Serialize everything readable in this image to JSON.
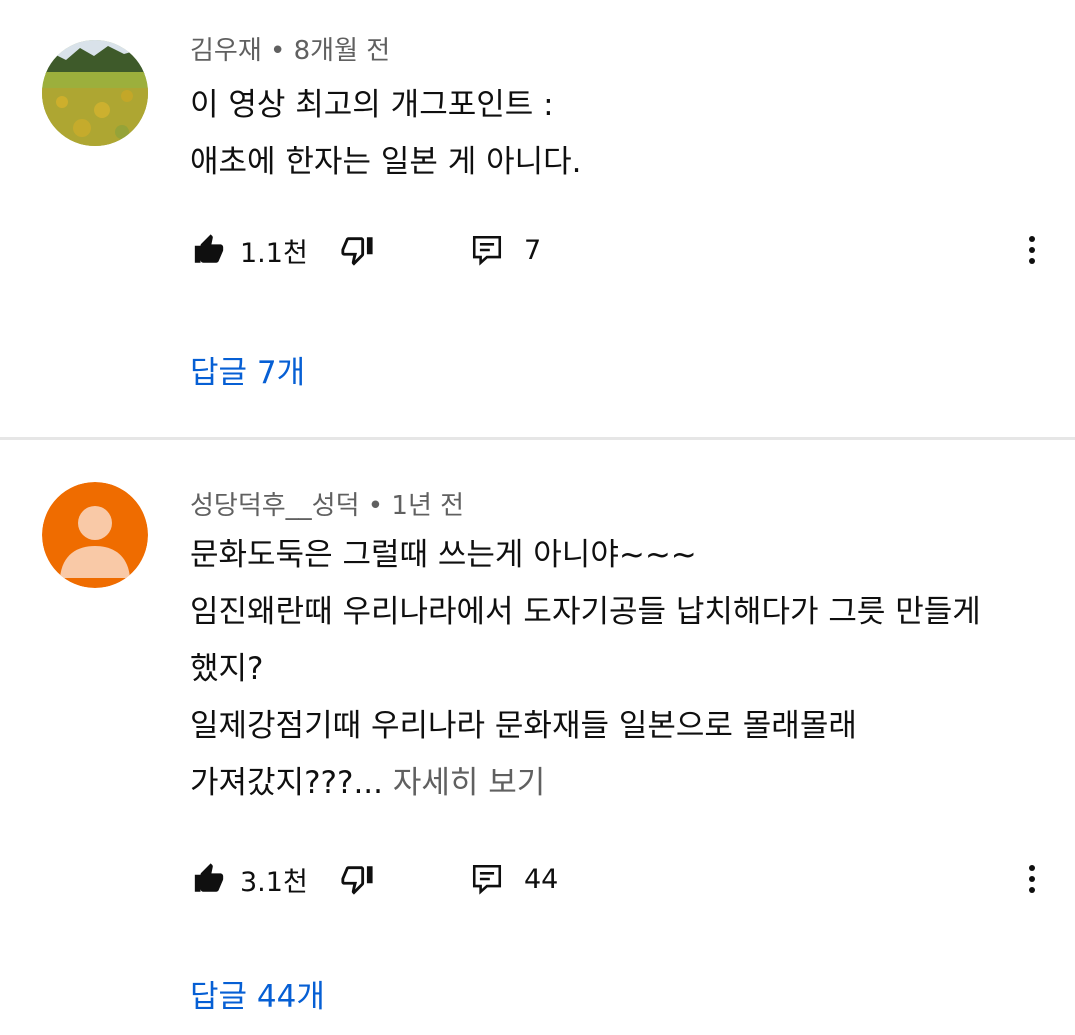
{
  "comments": [
    {
      "author": "김우재",
      "time": "8개월 전",
      "lines": [
        "이 영상 최고의 개그포인트 :",
        "애초에 한자는 일본 게 아니다."
      ],
      "more_label": "",
      "likes": "1.1천",
      "reply_count": "7",
      "replies_link": "답글 7개",
      "avatar": "landscape-photo-avatar"
    },
    {
      "author": "성당덕후__성덕",
      "time": "1년 전",
      "lines": [
        "문화도둑은 그럴때 쓰는게 아니야~~~",
        "임진왜란때 우리나라에서 도자기공들 납치해다가 그릇 만들게",
        "했지?",
        "일제강점기때 우리나라 문화재들 일본으로 몰래몰래",
        "가져갔지???..."
      ],
      "more_label": "자세히 보기",
      "likes": "3.1천",
      "reply_count": "44",
      "replies_link": "답글 44개",
      "avatar": "default-person-avatar"
    }
  ],
  "meta_separator": "•",
  "colors": {
    "link": "#065fd4",
    "meta": "#606060",
    "text": "#0f0f0f",
    "avatar_orange": "#ef6c00",
    "divider": "#e6e6e6"
  },
  "icons": [
    "thumb-up-filled-icon",
    "thumb-down-outline-icon",
    "reply-comment-icon",
    "more-vert-icon"
  ]
}
